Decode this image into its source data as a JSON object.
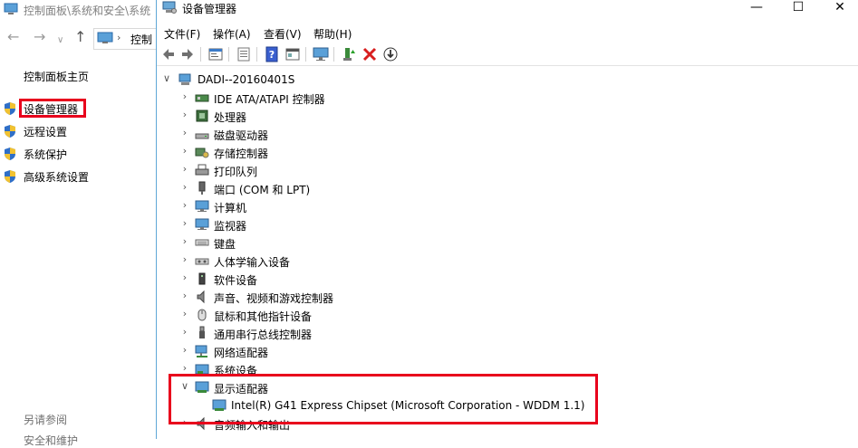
{
  "background_window": {
    "title": "控制面板\\系统和安全\\系统",
    "address_text": "控制",
    "home_link": "控制面板主页",
    "links": [
      {
        "label": "设备管理器",
        "icon": "shield-icon",
        "highlighted": true
      },
      {
        "label": "远程设置",
        "icon": "shield-icon"
      },
      {
        "label": "系统保护",
        "icon": "shield-icon"
      },
      {
        "label": "高级系统设置",
        "icon": "shield-icon"
      }
    ],
    "see_also": "另请参阅",
    "see_also_item": "安全和维护"
  },
  "device_manager": {
    "title": "设备管理器",
    "window_buttons": {
      "minimize": "—",
      "maximize": "☐",
      "close": "✕"
    },
    "menu": [
      "文件(F)",
      "操作(A)",
      "查看(V)",
      "帮助(H)"
    ],
    "toolbar_icons": [
      "back-icon",
      "forward-icon",
      "properties-icon",
      "view-icon",
      "help-icon",
      "show-hidden-icon",
      "monitor-icon",
      "update-driver-icon",
      "uninstall-icon",
      "download-icon"
    ],
    "root": {
      "label": "DADI--20160401S",
      "expanded": true
    },
    "categories": [
      {
        "label": "IDE ATA/ATAPI 控制器",
        "icon": "ide-icon"
      },
      {
        "label": "处理器",
        "icon": "cpu-icon"
      },
      {
        "label": "磁盘驱动器",
        "icon": "disk-icon"
      },
      {
        "label": "存储控制器",
        "icon": "storage-icon"
      },
      {
        "label": "打印队列",
        "icon": "printer-icon"
      },
      {
        "label": "端口 (COM 和 LPT)",
        "icon": "port-icon"
      },
      {
        "label": "计算机",
        "icon": "computer-icon"
      },
      {
        "label": "监视器",
        "icon": "monitor-icon"
      },
      {
        "label": "键盘",
        "icon": "keyboard-icon"
      },
      {
        "label": "人体学输入设备",
        "icon": "hid-icon"
      },
      {
        "label": "软件设备",
        "icon": "software-device-icon"
      },
      {
        "label": "声音、视频和游戏控制器",
        "icon": "sound-icon"
      },
      {
        "label": "鼠标和其他指针设备",
        "icon": "mouse-icon"
      },
      {
        "label": "通用串行总线控制器",
        "icon": "usb-icon"
      },
      {
        "label": "网络适配器",
        "icon": "network-icon"
      },
      {
        "label": "系统设备",
        "icon": "system-device-icon"
      },
      {
        "label": "显示适配器",
        "icon": "display-adapter-icon",
        "expanded": true
      },
      {
        "label": "音频输入和输出",
        "icon": "audio-icon"
      }
    ],
    "display_adapter_child": {
      "label": "Intel(R) G41 Express Chipset (Microsoft Corporation - WDDM 1.1)",
      "icon": "display-adapter-icon"
    }
  },
  "colors": {
    "highlight_red": "#e8001c",
    "selection": "#cce8ff",
    "window_border": "#5fa7d6"
  }
}
